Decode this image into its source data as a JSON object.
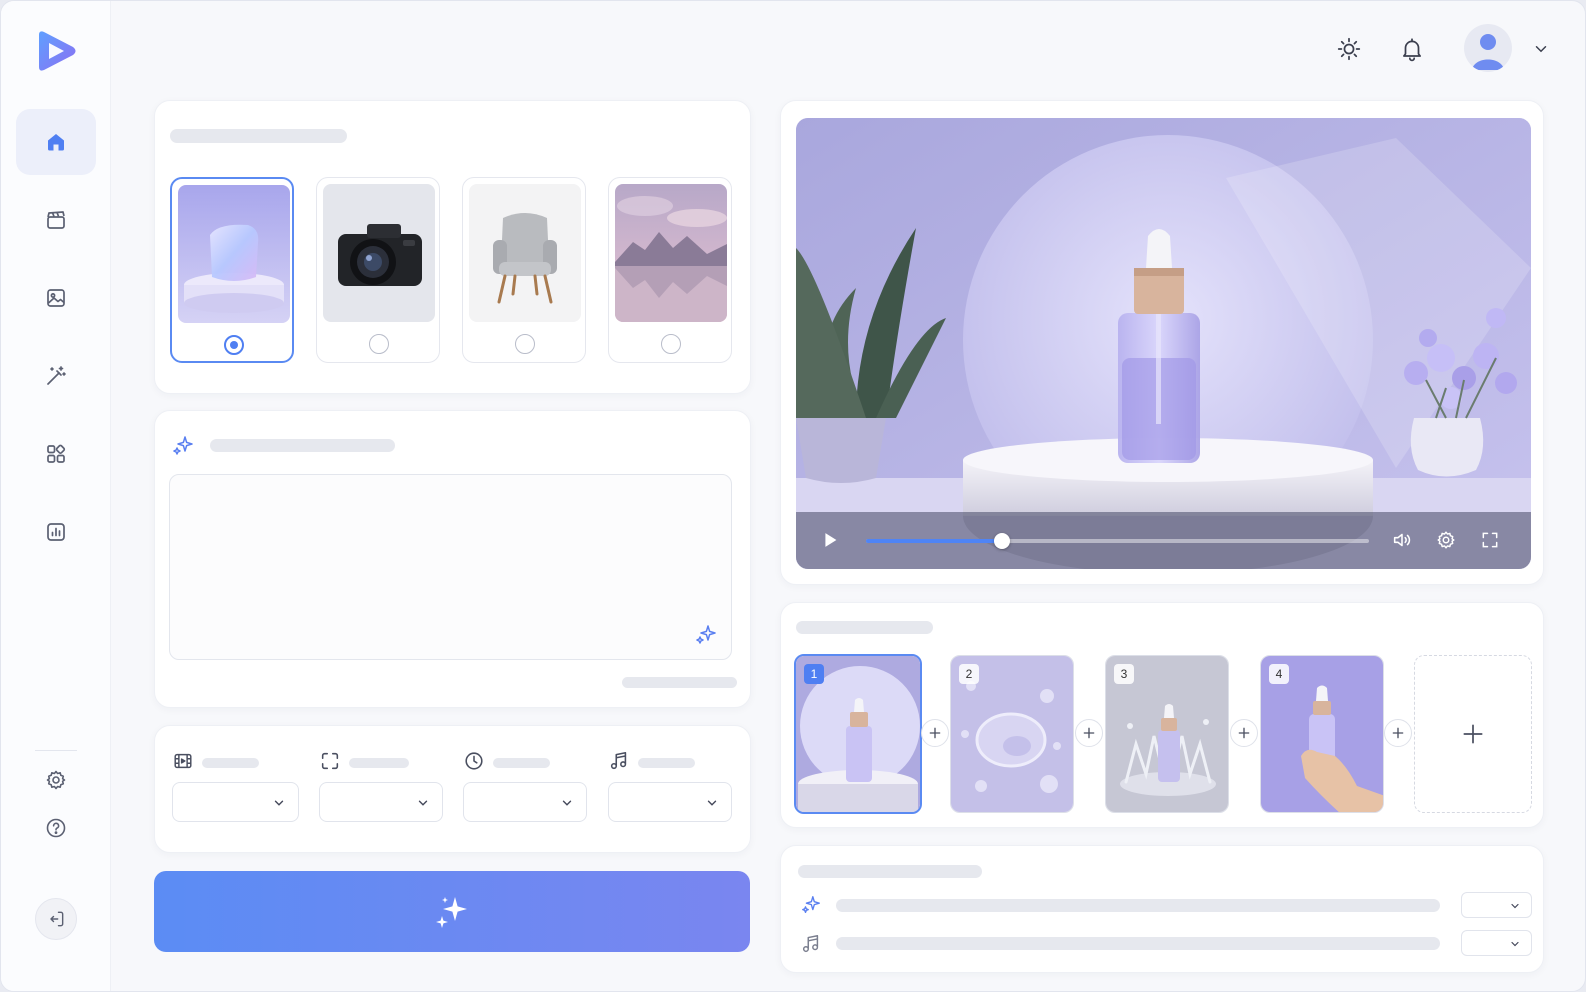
{
  "app": {
    "logo": "play-logo-icon"
  },
  "sidebar": {
    "items": [
      {
        "icon": "home-icon",
        "active": true
      },
      {
        "icon": "clapperboard-icon",
        "active": false
      },
      {
        "icon": "image-icon",
        "active": false
      },
      {
        "icon": "magic-wand-icon",
        "active": false
      },
      {
        "icon": "apps-grid-icon",
        "active": false
      },
      {
        "icon": "chart-icon",
        "active": false
      }
    ],
    "bottom_items": [
      {
        "icon": "gear-icon"
      },
      {
        "icon": "help-icon"
      }
    ],
    "logout_icon": "logout-icon"
  },
  "topbar": {
    "theme_icon": "sun-icon",
    "notifications_icon": "bell-icon",
    "avatar_icon": "user-avatar",
    "menu_icon": "chevron-down-icon"
  },
  "style_picker": {
    "options": [
      {
        "subject": "product-podium",
        "selected": true
      },
      {
        "subject": "camera",
        "selected": false
      },
      {
        "subject": "armchair",
        "selected": false
      },
      {
        "subject": "mountain-lake",
        "selected": false
      }
    ]
  },
  "prompt": {
    "header_icon": "sparkles-icon",
    "value": "",
    "enhance_icon": "sparkles-icon"
  },
  "settings": {
    "fields": [
      {
        "icon": "film-icon",
        "value": ""
      },
      {
        "icon": "aspect-ratio-icon",
        "value": ""
      },
      {
        "icon": "clock-icon",
        "value": ""
      },
      {
        "icon": "music-note-icon",
        "value": ""
      }
    ]
  },
  "generate": {
    "icon": "sparkles-icon"
  },
  "player": {
    "progress": 0.27,
    "icons": [
      "play-icon",
      "volume-icon",
      "gear-icon",
      "fullscreen-icon"
    ]
  },
  "storyboard": {
    "scenes": [
      {
        "number": "1",
        "subject": "serum-on-podium",
        "selected": true
      },
      {
        "number": "2",
        "subject": "water-droplets",
        "selected": false
      },
      {
        "number": "3",
        "subject": "water-splash",
        "selected": false
      },
      {
        "number": "4",
        "subject": "hand-holding-bottle",
        "selected": false
      }
    ],
    "add_icon": "plus-icon"
  },
  "audio": {
    "rows": [
      {
        "icon": "sparkles-icon",
        "value": ""
      },
      {
        "icon": "music-note-icon",
        "value": ""
      }
    ]
  },
  "colors": {
    "accent": "#4f7ff2",
    "gradient_start": "#5b8cf4",
    "gradient_end": "#7a86f0",
    "lavender": "#c9c8ea"
  }
}
